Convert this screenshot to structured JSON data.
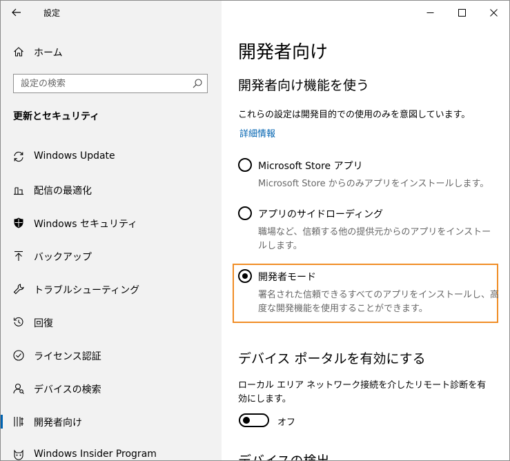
{
  "app": {
    "title": "設定"
  },
  "sidebar": {
    "home_label": "ホーム",
    "search_placeholder": "設定の検索",
    "section_heading": "更新とセキュリティ",
    "items": [
      {
        "label": "Windows Update",
        "icon": "sync-icon",
        "selected": false
      },
      {
        "label": "配信の最適化",
        "icon": "delivery-optimization-icon",
        "selected": false
      },
      {
        "label": "Windows セキュリティ",
        "icon": "shield-icon",
        "selected": false
      },
      {
        "label": "バックアップ",
        "icon": "backup-arrow-up-icon",
        "selected": false
      },
      {
        "label": "トラブルシューティング",
        "icon": "wrench-icon",
        "selected": false
      },
      {
        "label": "回復",
        "icon": "recovery-icon",
        "selected": false
      },
      {
        "label": "ライセンス認証",
        "icon": "check-circle-icon",
        "selected": false
      },
      {
        "label": "デバイスの検索",
        "icon": "person-search-icon",
        "selected": false
      },
      {
        "label": "開発者向け",
        "icon": "developer-tools-icon",
        "selected": true
      },
      {
        "label": "Windows Insider Program",
        "icon": "insider-cat-icon",
        "selected": false
      }
    ]
  },
  "main": {
    "page_title": "開発者向け",
    "dev_features_heading": "開発者向け機能を使う",
    "dev_features_desc": "これらの設定は開発目的での使用のみを意図しています。",
    "more_info_link": "詳細情報",
    "options": [
      {
        "label": "Microsoft Store アプリ",
        "desc": "Microsoft Store からのみアプリをインストールします。",
        "checked": false
      },
      {
        "label": "アプリのサイドローディング",
        "desc": "職場など、信頼する他の提供元からのアプリをインストールします。",
        "checked": false
      },
      {
        "label": "開発者モード",
        "desc": "署名された信頼できるすべてのアプリをインストールし、高度な開発機能を使用することができます。",
        "checked": true
      }
    ],
    "device_portal_heading": "デバイス ポータルを有効にする",
    "device_portal_desc": "ローカル エリア ネットワーク接続を介したリモート診断を有効にします。",
    "device_portal_toggle_state": "オフ",
    "device_discovery_heading": "デバイスの検出"
  },
  "colors": {
    "accent": "#0063b1",
    "focus_outline": "#f08c24",
    "sidebar_bg": "#f2f2f2",
    "secondary_text": "#666666"
  }
}
